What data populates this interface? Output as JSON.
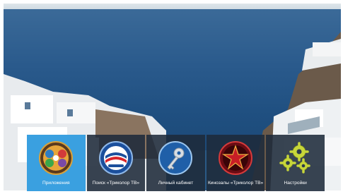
{
  "menu": {
    "items": [
      {
        "label": "Приложения",
        "icon": "apps-icon",
        "active": true
      },
      {
        "label": "Поиск «Триколор ТВ»",
        "icon": "tricolor-search-icon",
        "active": false
      },
      {
        "label": "Личный кабинет",
        "icon": "key-icon",
        "active": false
      },
      {
        "label": "Кинозалы «Триколор ТВ»",
        "icon": "cinema-star-icon",
        "active": false
      },
      {
        "label": "Настройки",
        "icon": "gears-icon",
        "active": false
      }
    ],
    "colors": {
      "active": "#3aa0e0",
      "tile": "#1e2a3a"
    }
  }
}
